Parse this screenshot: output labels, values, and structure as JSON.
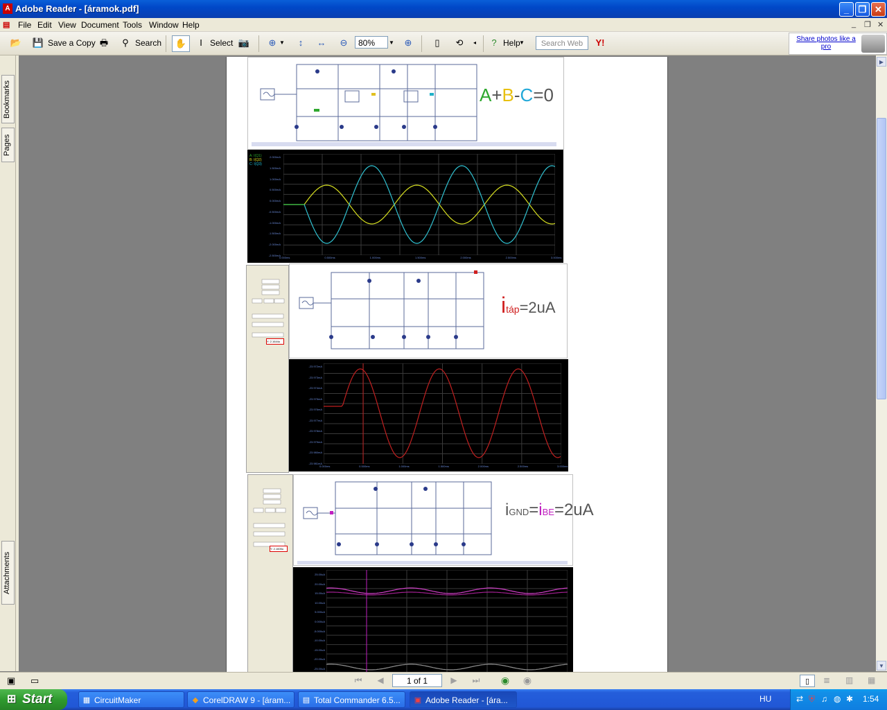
{
  "window": {
    "title": "Adobe Reader - [áramok.pdf]",
    "app_icon": "adobe-reader-icon"
  },
  "menu": [
    "File",
    "Edit",
    "View",
    "Document",
    "Tools",
    "Window",
    "Help"
  ],
  "toolbar": {
    "save_copy": "Save a Copy",
    "search": "Search",
    "select": "Select",
    "zoom": "80%",
    "help": "Help",
    "search_web_placeholder": "Search Web",
    "ad_text": "Share photos like a pro"
  },
  "nav_tabs": {
    "bookmarks": "Bookmarks",
    "pages": "Pages",
    "attachments": "Attachments"
  },
  "document": {
    "eq1": {
      "a": "A",
      "plus": "+",
      "b": "B",
      "minus": "-",
      "c": "C",
      "eq": "=",
      "zero": "0"
    },
    "eq2": {
      "i": "i",
      "sub": "táp",
      "rest": "=2uA"
    },
    "eq3": {
      "i1": "i",
      "sub1": "GND",
      "eq1": "=",
      "i2": "i",
      "sub2": "BE",
      "rest": "=2uA"
    },
    "scope1_ylabels": [
      "2.000mA",
      "1.500mA",
      "1.000mA",
      "0.500mA",
      "0.000mA",
      "-0.500mA",
      "-1.000mA",
      "-1.500mA",
      "-2.000mA",
      "-2.500mA"
    ],
    "scope1_xlabels": [
      "0.000ms",
      "0.500ms",
      "1.000ms",
      "1.500ms",
      "2.000ms",
      "2.500ms",
      "3.000ms"
    ],
    "scope1_legend": [
      "A: I(Q1)",
      "B: I(Q2)",
      "C: I(Q3)"
    ],
    "scope2_ylabels": [
      "-23.972mA",
      "-23.973mA",
      "-23.974mA",
      "-23.975mA",
      "-23.976mA",
      "-23.977mA",
      "-23.978mA",
      "-23.979mA",
      "-23.980mA",
      "-23.981mA"
    ],
    "scope2_xlabels": [
      "0.000ms",
      "0.500ms",
      "1.000ms",
      "1.500ms",
      "2.000ms",
      "2.500ms",
      "3.000ms"
    ],
    "scope3_ylabels": [
      "25.00uA",
      "20.00uA",
      "15.00uA",
      "10.00uA",
      "5.000uA",
      "0.000uA",
      "-5.000uA",
      "-10.00uA",
      "-15.00uA",
      "-20.00uA",
      "-25.00uA"
    ],
    "panel_readout1": "Y: 2.1644u",
    "panel_readout2": "Y: 2.1605u"
  },
  "status": {
    "page": "1 of 1"
  },
  "taskbar": {
    "start": "Start",
    "tasks": [
      "CircuitMaker",
      "CorelDRAW 9 - [áram...",
      "Total Commander 6.5...",
      "Adobe Reader - [ára..."
    ],
    "lang": "HU",
    "clock": "1:54"
  }
}
